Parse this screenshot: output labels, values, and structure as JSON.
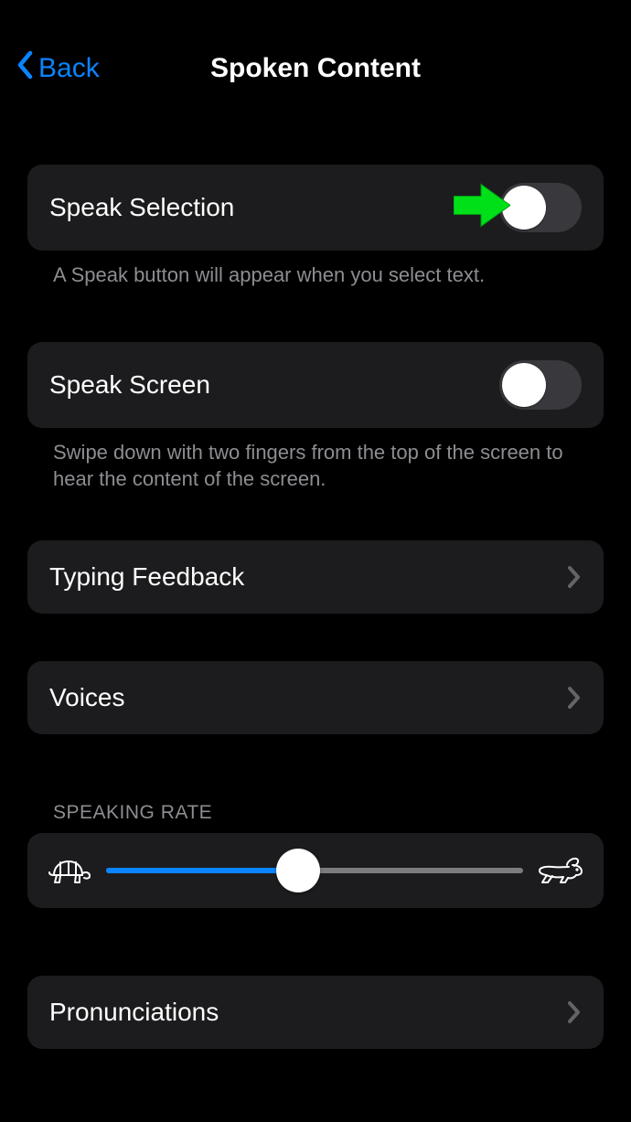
{
  "nav": {
    "back_label": "Back",
    "title": "Spoken Content"
  },
  "rows": {
    "speak_selection": {
      "label": "Speak Selection",
      "toggle_on": false,
      "footer": "A Speak button will appear when you select text."
    },
    "speak_screen": {
      "label": "Speak Screen",
      "toggle_on": false,
      "footer": "Swipe down with two fingers from the top of the screen to hear the content of the screen."
    },
    "typing_feedback": {
      "label": "Typing Feedback"
    },
    "voices": {
      "label": "Voices"
    },
    "pronunciations": {
      "label": "Pronunciations"
    }
  },
  "speaking_rate": {
    "header": "SPEAKING RATE",
    "value_percent": 46
  },
  "annotation": {
    "type": "arrow",
    "color": "#00e018",
    "points_at": "speak-selection-toggle"
  }
}
